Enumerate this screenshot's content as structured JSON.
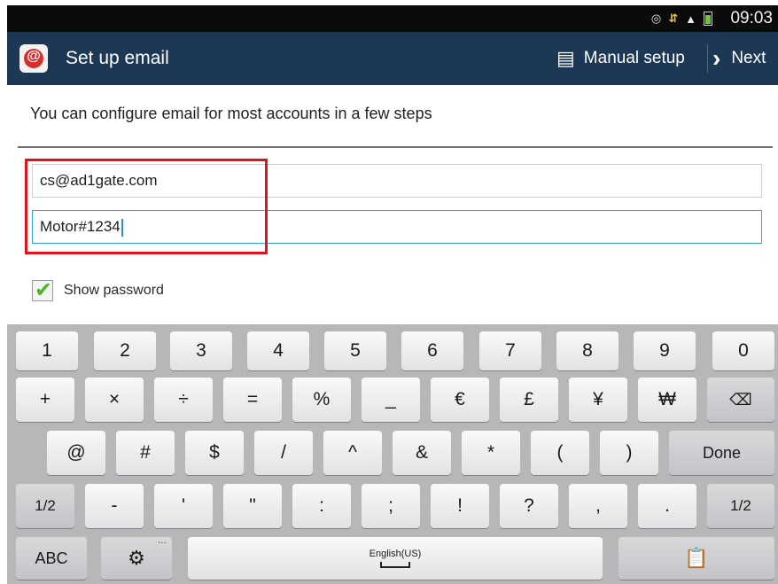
{
  "status_bar": {
    "time": "09:03",
    "icons": [
      "eye-icon",
      "data-icon",
      "signal-icon",
      "battery-icon"
    ]
  },
  "action_bar": {
    "title": "Set up email",
    "manual_setup_label": "Manual setup",
    "next_label": "Next",
    "background_color": "#1c3855"
  },
  "content": {
    "instructions": "You can configure email for most accounts in a few steps",
    "email_value": "cs@ad1gate.com",
    "password_value": "Motor#1234",
    "show_password_label": "Show password",
    "show_password_checked": true,
    "highlight_color": "#e0121a"
  },
  "keyboard": {
    "row1": [
      "1",
      "2",
      "3",
      "4",
      "5",
      "6",
      "7",
      "8",
      "9",
      "0"
    ],
    "row2": [
      "+",
      "×",
      "÷",
      "=",
      "%",
      "_",
      "€",
      "£",
      "¥",
      "₩"
    ],
    "row3": [
      "@",
      "#",
      "$",
      "/",
      "^",
      "&",
      "*",
      "(",
      ")"
    ],
    "done_label": "Done",
    "row4": [
      "-",
      "'",
      "\"",
      ":",
      ";",
      "!",
      "?",
      ",",
      "."
    ],
    "page_label": "1/2",
    "abc_label": "ABC",
    "space_label": "English(US)",
    "ellipsis": "..."
  }
}
